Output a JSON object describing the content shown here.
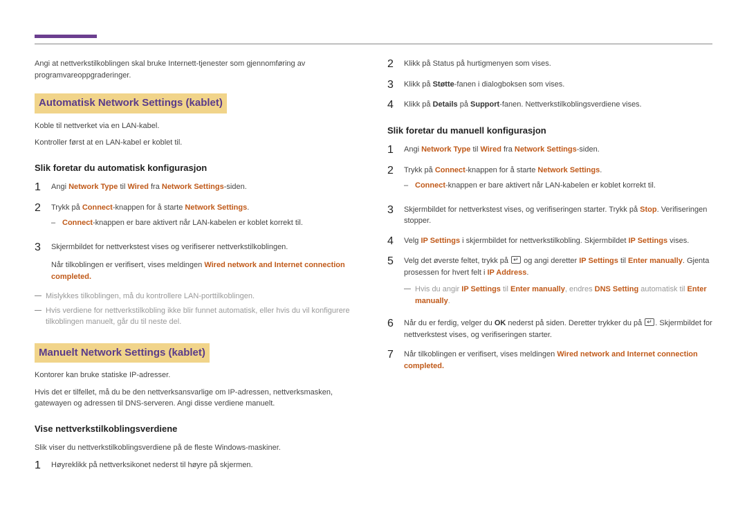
{
  "left": {
    "intro": "Angi at nettverkstilkoblingen skal bruke Internett-tjenester som gjennomføring av programvareoppgraderinger.",
    "section1_title": "Automatisk Network Settings  (kablet)",
    "p1a": "Koble til nettverket via en LAN-kabel.",
    "p1b": "Kontroller først at en LAN-kabel er koblet til.",
    "sub1": "Slik foretar du automatisk konfigurasjon",
    "s1": {
      "pre": "Angi ",
      "nt": "Network Type",
      "mid": " til ",
      "wired": "Wired",
      "mid2": " fra ",
      "ns": "Network Settings",
      "post": "-siden."
    },
    "s2": {
      "pre": "Trykk på ",
      "conn": "Connect",
      "mid": "-knappen for å starte ",
      "ns": "Network Settings",
      "post": "."
    },
    "s2d": {
      "conn": "Connect",
      "txt": "-knappen er bare aktivert når LAN-kabelen er koblet korrekt til."
    },
    "s3": "Skjermbildet for nettverkstest vises og verifiserer nettverkstilkoblingen.",
    "s3b_pre": "Når tilkoblingen er verifisert, vises meldingen ",
    "s3b_hl": "Wired network and Internet connection completed.",
    "n1": "Mislykkes tilkoblingen, må du kontrollere LAN-porttilkoblingen.",
    "n2": "Hvis verdiene for nettverkstilkobling ikke blir funnet automatisk, eller hvis du vil konfigurere tilkoblingen manuelt, går du til neste del.",
    "section2_title": "Manuelt Network Settings (kablet)",
    "p2a": "Kontorer kan bruke statiske IP-adresser.",
    "p2b": "Hvis det er tilfellet, må du be den nettverksansvarlige om IP-adressen, nettverksmasken, gatewayen og adressen til DNS-serveren. Angi disse verdiene manuelt.",
    "sub2": "Vise nettverkstilkoblingsverdiene",
    "p2c": "Slik viser du nettverkstilkoblingsverdiene på de fleste Windows-maskiner.",
    "s_b1": "Høyreklikk på nettverksikonet nederst til høyre på skjermen."
  },
  "right": {
    "s2": "Klikk på Status på hurtigmenyen som vises.",
    "s3_pre": "Klikk på ",
    "s3_b": "Støtte",
    "s3_post": "-fanen i dialogboksen som vises.",
    "s4_pre": "Klikk på ",
    "s4_b": "Details",
    "s4_mid": " på ",
    "s4_b2": "Support",
    "s4_post": "-fanen. Nettverkstilkoblingsverdiene vises.",
    "sub": "Slik foretar du manuell konfigurasjon",
    "m1": {
      "pre": "Angi ",
      "nt": "Network Type",
      "mid": " til ",
      "wired": "Wired",
      "mid2": " fra ",
      "ns": "Network Settings",
      "post": "-siden."
    },
    "m2": {
      "pre": "Trykk på ",
      "conn": "Connect",
      "mid": "-knappen for å starte ",
      "ns": "Network Settings",
      "post": "."
    },
    "m2d": {
      "conn": "Connect",
      "txt": "-knappen er bare aktivert når LAN-kabelen er koblet korrekt til."
    },
    "m3_pre": "Skjermbildet for nettverkstest vises, og verifiseringen starter. Trykk på ",
    "m3_stop": "Stop",
    "m3_post": ". Verifiseringen stopper.",
    "m4_pre": "Velg ",
    "m4_ip": "IP Settings",
    "m4_mid": " i skjermbildet for nettverkstilkobling. Skjermbildet ",
    "m4_ip2": "IP Settings",
    "m4_post": " vises.",
    "m5_pre": "Velg det øverste feltet, trykk på ",
    "m5_mid": " og angi deretter ",
    "m5_ip": "IP Settings",
    "m5_mid2": " til ",
    "m5_em": "Enter manually",
    "m5_post": ". Gjenta prosessen for hvert felt i ",
    "m5_ipaddr": "IP Address",
    "m5_end": ".",
    "m5n_pre": "Hvis du angir ",
    "m5n_ip": "IP Settings",
    "m5n_mid": " til ",
    "m5n_em": "Enter manually",
    "m5n_mid2": ", endres ",
    "m5n_dns": "DNS Setting",
    "m5n_mid3": " automatisk til ",
    "m5n_em2": "Enter manually",
    "m5n_end": ".",
    "m6_pre": "Når du er ferdig, velger du ",
    "m6_ok": "OK",
    "m6_mid": " nederst på siden. Deretter trykker du på ",
    "m6_post": ". Skjermbildet for nettverkstest vises, og verifiseringen starter.",
    "m7_pre": "Når tilkoblingen er verifisert, vises meldingen ",
    "m7_hl": "Wired network and Internet connection completed."
  },
  "nums": {
    "n1": "1",
    "n2": "2",
    "n3": "3",
    "n4": "4",
    "n5": "5",
    "n6": "6",
    "n7": "7"
  },
  "dash": "‒"
}
